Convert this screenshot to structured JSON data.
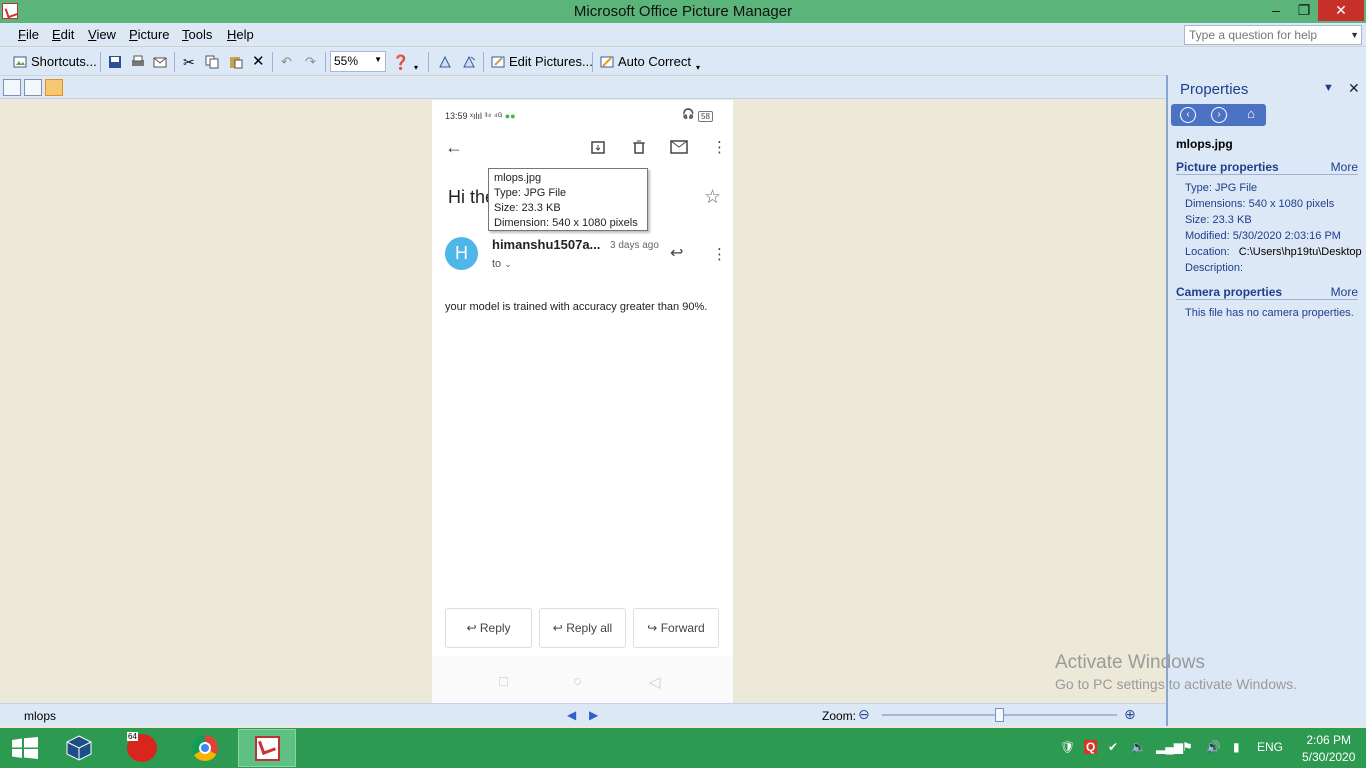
{
  "window": {
    "title": "Microsoft Office Picture Manager",
    "min": "‒",
    "max": "❐",
    "close": "✕"
  },
  "menu": {
    "items": [
      {
        "key": "F",
        "rest": "ile"
      },
      {
        "key": "E",
        "rest": "dit"
      },
      {
        "key": "V",
        "rest": "iew"
      },
      {
        "key": "P",
        "rest": "icture"
      },
      {
        "key": "T",
        "rest": "ools"
      },
      {
        "key": "H",
        "rest": "elp"
      }
    ],
    "help_placeholder": "Type a question for help"
  },
  "toolbar": {
    "shortcuts_label": "Shortcuts...",
    "zoom_value": "55%",
    "edit_pictures_label": "Edit Pictures...",
    "auto_correct_label": "Auto Correct"
  },
  "phone": {
    "status_time": "13:59",
    "status_signal": "ˣılıl ³⁴ ⁴ᴳ",
    "battery": "58",
    "subject": "Hi the",
    "avatar_letter": "H",
    "sender": "himanshu1507a...",
    "date": "3 days ago",
    "to": "to",
    "body": "your model is trained with accuracy greater than 90%.",
    "reply": "Reply",
    "reply_all": "Reply all",
    "forward": "Forward"
  },
  "tooltip": {
    "name": "mlops.jpg",
    "type": "Type: JPG File",
    "size": "Size: 23.3 KB",
    "dimension": "Dimension: 540 x 1080 pixels"
  },
  "properties": {
    "title": "Properties",
    "filename": "mlops.jpg",
    "picture_heading": "Picture properties",
    "more": "More",
    "type": "Type: JPG File",
    "dimensions": "Dimensions: 540 x 1080 pixels",
    "size": "Size: 23.3 KB",
    "modified": "Modified: 5/30/2020 2:03:16 PM",
    "location_label": "Location:",
    "location_value": "C:\\Users\\hp19tu\\Desktop",
    "description": "Description:",
    "camera_heading": "Camera properties",
    "camera_text": "This file has no camera properties."
  },
  "statusbar": {
    "filename": "mlops",
    "zoom_label": "Zoom:",
    "zoom_level": 0.5
  },
  "watermark": {
    "line1": "Activate Windows",
    "line2": "Go to PC settings to activate Windows."
  },
  "taskbar": {
    "lang": "ENG",
    "time": "2:06 PM",
    "date": "5/30/2020",
    "badge64": "64"
  },
  "colors": {
    "titlebar": "#5bb57a",
    "taskbar": "#2d9a52",
    "panel": "#dde8f7",
    "accent": "#1d3f8c"
  }
}
